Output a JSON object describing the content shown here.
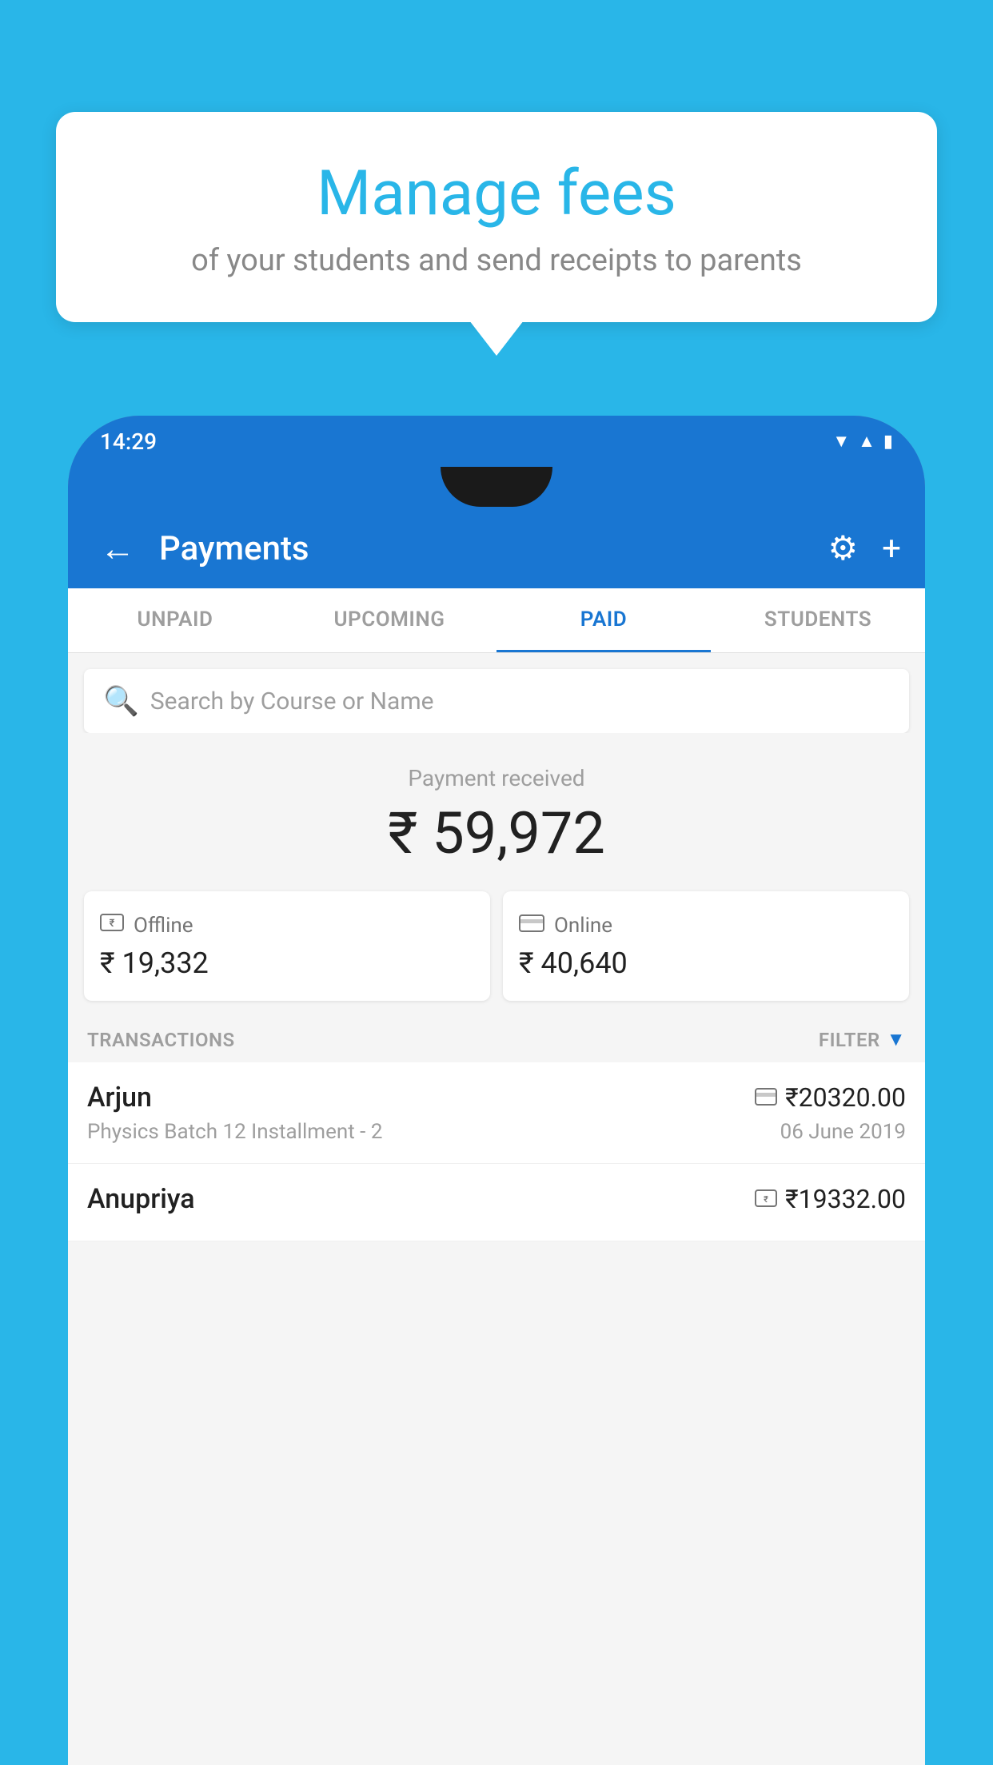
{
  "background_color": "#29b6e8",
  "speech_bubble": {
    "title": "Manage fees",
    "subtitle": "of your students and send receipts to parents"
  },
  "phone": {
    "status_bar": {
      "time": "14:29",
      "icons": [
        "wifi",
        "signal",
        "battery"
      ]
    },
    "app_bar": {
      "back_label": "←",
      "title": "Payments",
      "settings_icon": "⚙",
      "add_icon": "+"
    },
    "tabs": [
      {
        "label": "UNPAID",
        "active": false
      },
      {
        "label": "UPCOMING",
        "active": false
      },
      {
        "label": "PAID",
        "active": true
      },
      {
        "label": "STUDENTS",
        "active": false
      }
    ],
    "search": {
      "placeholder": "Search by Course or Name"
    },
    "payment_summary": {
      "label": "Payment received",
      "amount": "₹ 59,972",
      "cards": [
        {
          "icon": "offline",
          "type": "Offline",
          "amount": "₹ 19,332"
        },
        {
          "icon": "online",
          "type": "Online",
          "amount": "₹ 40,640"
        }
      ]
    },
    "transactions": {
      "label": "TRANSACTIONS",
      "filter_label": "FILTER",
      "items": [
        {
          "name": "Arjun",
          "description": "Physics Batch 12 Installment - 2",
          "amount": "₹20320.00",
          "date": "06 June 2019",
          "payment_type": "online"
        },
        {
          "name": "Anupriya",
          "description": "",
          "amount": "₹19332.00",
          "date": "",
          "payment_type": "offline"
        }
      ]
    }
  }
}
